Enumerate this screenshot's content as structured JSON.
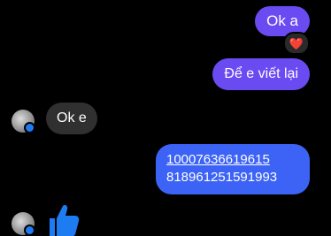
{
  "messages": [
    {
      "id": "m1",
      "direction": "outgoing",
      "text": "Ok a",
      "reaction": "❤️"
    },
    {
      "id": "m2",
      "direction": "outgoing",
      "text": "Để e viết lại"
    },
    {
      "id": "m3",
      "direction": "incoming",
      "text": "Ok e"
    },
    {
      "id": "m4",
      "direction": "outgoing",
      "link_text": "10007636619615",
      "text": "818961251591993"
    },
    {
      "id": "m5",
      "direction": "incoming",
      "sticker": "thumbs-up-icon"
    }
  ],
  "colors": {
    "outgoing_bubble": "#6a4bf2",
    "incoming_bubble": "#303030",
    "link_bubble": "#3c63f5",
    "background": "#000000",
    "reaction_heart": "#e6233b"
  }
}
